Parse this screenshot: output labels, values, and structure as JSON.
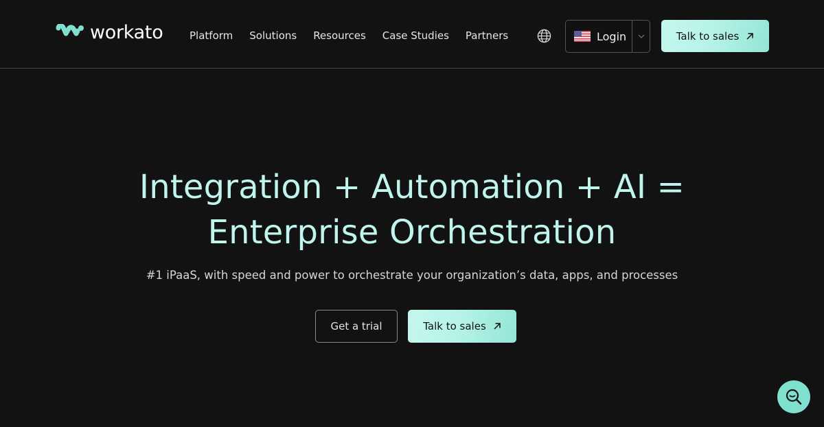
{
  "header": {
    "logo_text": "workato",
    "nav": [
      {
        "label": "Platform"
      },
      {
        "label": "Solutions"
      },
      {
        "label": "Resources"
      },
      {
        "label": "Case Studies"
      },
      {
        "label": "Partners"
      }
    ],
    "globe_icon": "globe-icon",
    "login_label": "Login",
    "login_flag": "us-flag-icon",
    "talk_to_sales_label": "Talk to sales"
  },
  "hero": {
    "title_line1": "Integration + Automation + AI =",
    "title_line2": "Enterprise Orchestration",
    "subtitle": "#1 iPaaS, with speed and power to orchestrate your organization’s data, apps, and processes",
    "trial_label": "Get a trial",
    "sales_label": "Talk to sales"
  },
  "floating": {
    "search_icon": "search-icon"
  },
  "colors": {
    "background": "#121212",
    "accent": "#7fe0d0",
    "title": "#bff5ec",
    "button_gradient_start": "#c4f7ee",
    "button_gradient_end": "#93e6d6"
  }
}
